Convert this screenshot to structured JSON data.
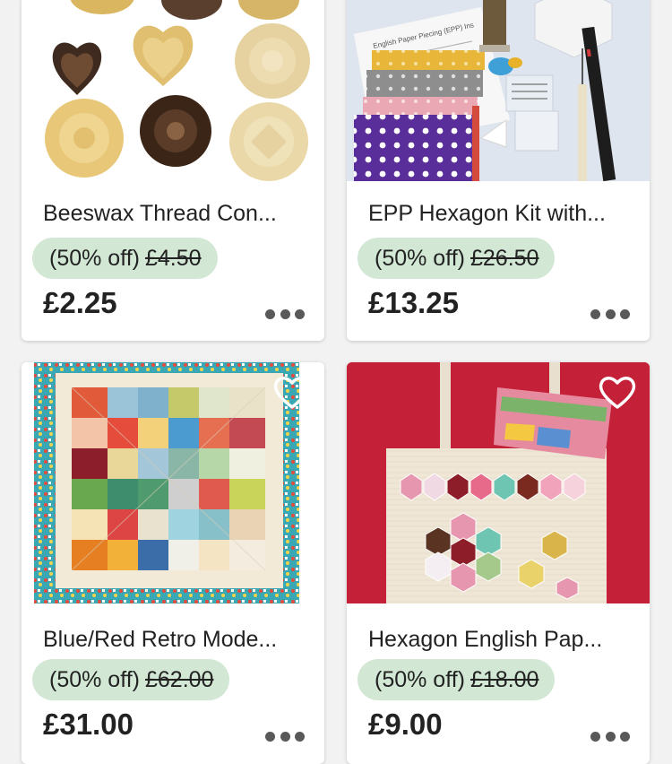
{
  "products": [
    {
      "title": "Beeswax Thread Con...",
      "discount": "(50% off)",
      "original_price": "£4.50",
      "price": "£2.25"
    },
    {
      "title": "EPP Hexagon Kit with...",
      "discount": "(50% off)",
      "original_price": "£26.50",
      "price": "£13.25"
    },
    {
      "title": "Blue/Red Retro Mode...",
      "discount": "(50% off)",
      "original_price": "£62.00",
      "price": "£31.00"
    },
    {
      "title": "Hexagon English Pap...",
      "discount": "(50% off)",
      "original_price": "£18.00",
      "price": "£9.00"
    }
  ],
  "icons": {
    "favorite": "heart-outline-icon",
    "more": "more-options-icon"
  },
  "colors": {
    "discount_pill": "#d2e8d5",
    "text": "#222222"
  },
  "image_texts": {
    "epp_instructions": "English Paper Piecing (EPP) Ins"
  }
}
